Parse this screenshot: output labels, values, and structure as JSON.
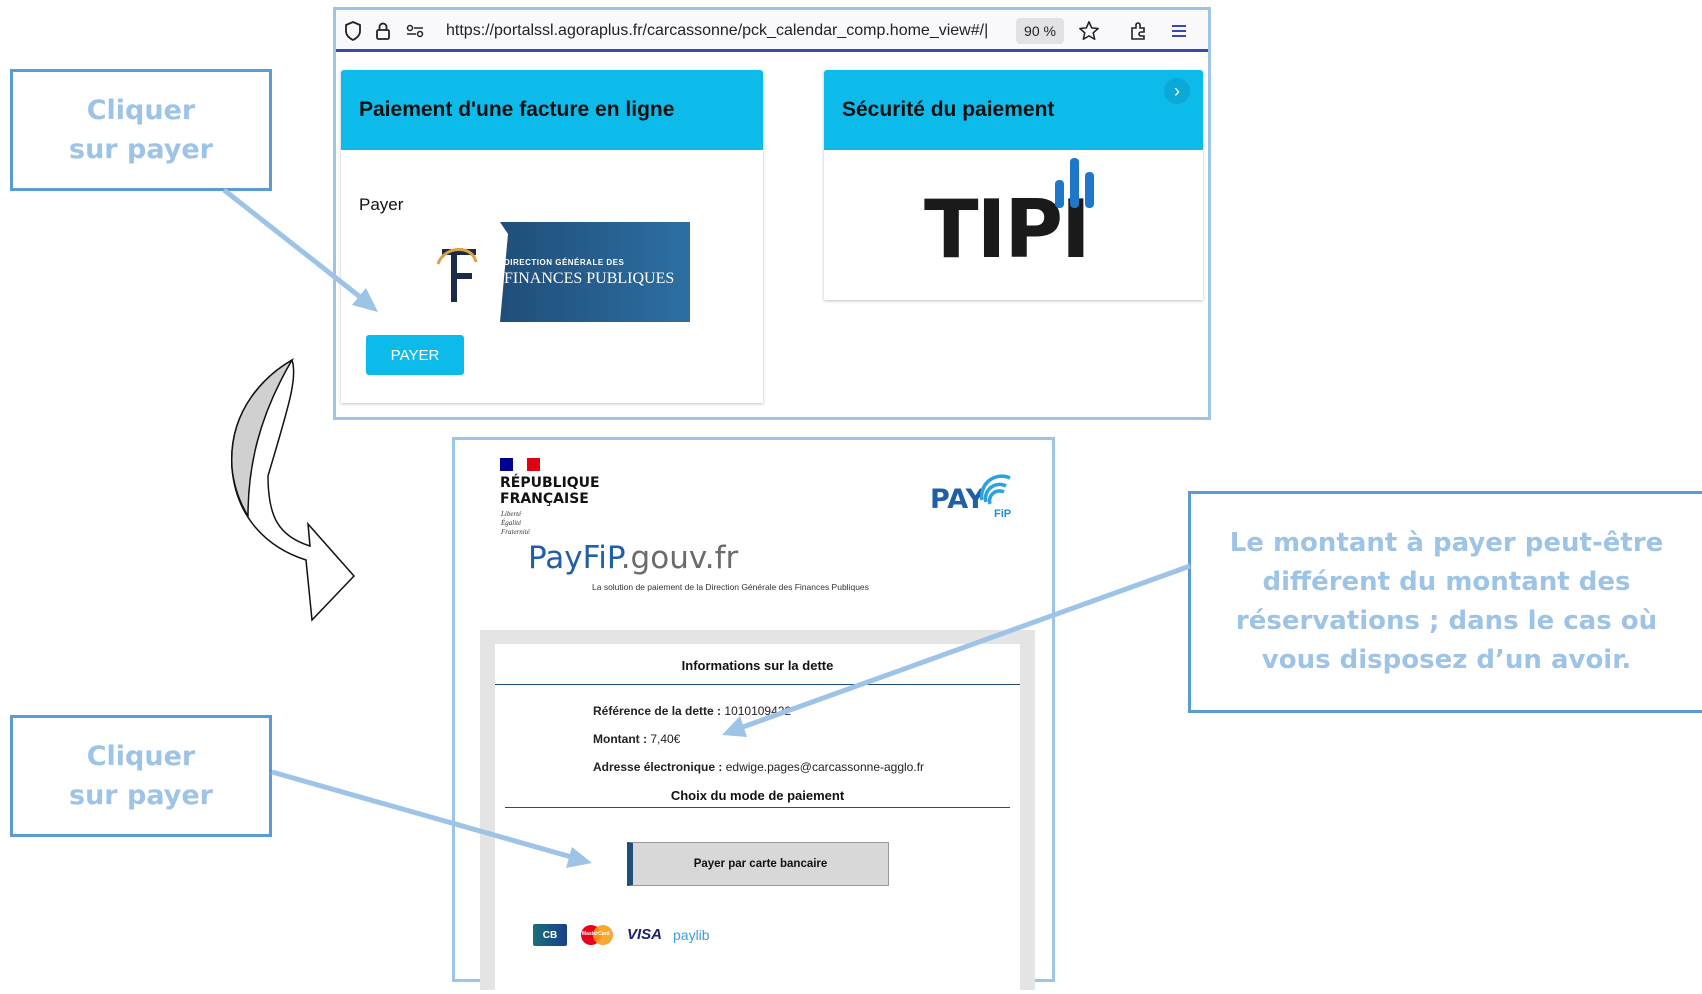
{
  "callouts": {
    "top_left": {
      "line1": "Cliquer",
      "line2": "sur payer"
    },
    "bottom_left": {
      "line1": "Cliquer",
      "line2": "sur payer"
    },
    "right": {
      "line1": "Le montant à payer peut-être",
      "line2": "différent du montant des",
      "line3": "réservations ; dans le cas où",
      "line4": "vous disposez d’un avoir."
    }
  },
  "browser": {
    "url": "https://portalssl.agoraplus.fr/carcassonne/pck_calendar_comp.home_view#/|",
    "url_domain": "agoraplus.fr",
    "zoom": "90 %",
    "icons": [
      "shield-icon",
      "lock-icon",
      "site-permissions-icon",
      "star-icon",
      "extensions-icon",
      "menu-icon"
    ]
  },
  "cards": {
    "payment": {
      "title": "Paiement d'une facture en ligne",
      "payer_label": "Payer",
      "button_label": "PAYER",
      "dgfip_logo": {
        "line1": "DIRECTION GÉNÉRALE DES",
        "line2": "FINANCES PUBLIQUES"
      }
    },
    "security": {
      "title": "Sécurité du paiement",
      "logo_text": "TIPI"
    }
  },
  "payfip": {
    "republique": {
      "line1": "RÉPUBLIQUE",
      "line2": "FRANÇAISE",
      "motto1": "Liberté",
      "motto2": "Égalité",
      "motto3": "Fraternité"
    },
    "pay_logo": {
      "text": "PAY",
      "sub": "FiP"
    },
    "site_name_a": "PayFiP",
    "site_name_b": ".gouv.fr",
    "tagline": "La solution de paiement de la Direction Générale des Finances Publiques",
    "info_title": "Informations sur la dette",
    "ref_label": "Référence de la dette :",
    "ref_value": "1010109422",
    "amount_label": "Montant :",
    "amount_value": "7,40€",
    "email_label": "Adresse électronique :",
    "email_value": "edwige.pages@carcassonne-agglo.fr",
    "mode_title": "Choix du mode de paiement",
    "card_button": "Payer par carte bancaire",
    "card_logos": {
      "cb": "CB",
      "mastercard": "MasterCard",
      "visa": "VISA",
      "paylib": "paylib"
    }
  },
  "colors": {
    "accent": "#0dbbea",
    "callout_border": "#5b9bd5",
    "callout_text": "#9dc3e6",
    "arrow": "#9dc3e6"
  }
}
